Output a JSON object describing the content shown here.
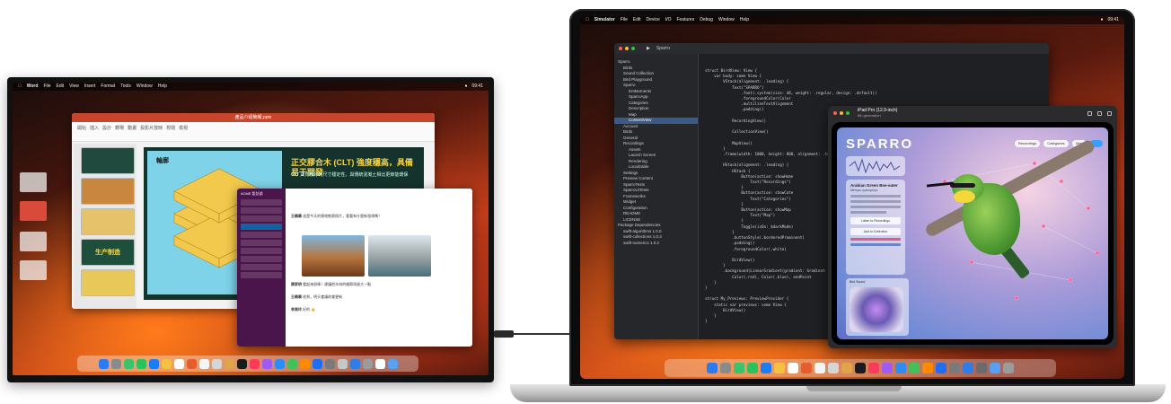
{
  "monitor": {
    "menubar": {
      "app": "Word",
      "items": [
        "File",
        "Edit",
        "View",
        "Insert",
        "Format",
        "Tools",
        "Window",
        "Help"
      ],
      "clock": "09:41"
    },
    "presentation": {
      "window_title": "產品介紹簡報.pptx",
      "ribbon_tabs": [
        "開始",
        "插入",
        "設計",
        "轉場",
        "動畫",
        "投影片放映",
        "校閱",
        "檢視"
      ],
      "slide_heading": "輪廓",
      "slide_title": "正交膠合木 (CLT) 強度穩高，具備易于開發",
      "slide_subtitle": "CLT 具有較好的尺寸穩定性，與傳統混凝土相比更節能環保",
      "thumb_label": "生产制造"
    },
    "chat": {
      "workspace": "ACME 設計部",
      "messages": [
        {
          "author": "王曉華",
          "text": "這是今天的實地勘察照片，看看有什麼新發現嗎？"
        },
        {
          "author": "陳家明",
          "text": "看起來很棒！建議把木材的細節再放大一點"
        },
        {
          "author": "王曉華",
          "text": "收到，明天會議前會更新"
        },
        {
          "author": "李美玲",
          "text": "好的 👍"
        }
      ]
    },
    "dock_colors": [
      "#2b7bf0",
      "#8a8a8a",
      "#3ac36b",
      "#2cc25b",
      "#1b7cf6",
      "#f6c040",
      "#ffffff",
      "#e55c2e",
      "#f5f5f5",
      "#d5d5d5",
      "#e0a54a",
      "#1b1b1b",
      "#fb3b5b",
      "#a05af5",
      "#2d8cf5",
      "#44c05a",
      "#ff8a00",
      "#1f6df2",
      "#7a7a7a",
      "#c7c7c7",
      "#2f7ee8",
      "#9b9b9b",
      "#ffffff",
      "#5aa0f0"
    ]
  },
  "macbook": {
    "menubar": {
      "app": "Simulator",
      "items": [
        "File",
        "Edit",
        "Device",
        "I/O",
        "Features",
        "Debug",
        "Window",
        "Help"
      ],
      "clock": "09:41"
    },
    "xcode": {
      "scheme": "Sparro",
      "navigator": [
        {
          "label": "Sparro",
          "indent": 0
        },
        {
          "label": "Birds",
          "indent": 1
        },
        {
          "label": "Sound Collection",
          "indent": 1
        },
        {
          "label": "Bird Playground",
          "indent": 1
        },
        {
          "label": "Sparro",
          "indent": 1
        },
        {
          "label": "EntMoments",
          "indent": 2
        },
        {
          "label": "SparroApp",
          "indent": 2
        },
        {
          "label": "Categories",
          "indent": 2
        },
        {
          "label": "Description",
          "indent": 2
        },
        {
          "label": "Map",
          "indent": 2
        },
        {
          "label": "ContentView",
          "indent": 2,
          "selected": true
        },
        {
          "label": "Account",
          "indent": 1
        },
        {
          "label": "Birds",
          "indent": 1
        },
        {
          "label": "General",
          "indent": 1
        },
        {
          "label": "Recordings",
          "indent": 1
        },
        {
          "label": "Assets",
          "indent": 2
        },
        {
          "label": "Launch Screen",
          "indent": 2
        },
        {
          "label": "Rendering",
          "indent": 2
        },
        {
          "label": "Localizable",
          "indent": 2
        },
        {
          "label": "Settings",
          "indent": 1
        },
        {
          "label": "Preview Content",
          "indent": 1
        },
        {
          "label": "SparroTests",
          "indent": 1
        },
        {
          "label": "SparroUITests",
          "indent": 1
        },
        {
          "label": "Frameworks",
          "indent": 1
        },
        {
          "label": "Widget",
          "indent": 1
        },
        {
          "label": "Configuration",
          "indent": 1
        },
        {
          "label": "README",
          "indent": 1
        },
        {
          "label": "LICENSE",
          "indent": 1
        },
        {
          "label": "Package Dependencies",
          "indent": 0
        },
        {
          "label": "swift-algorithms 1.0.0",
          "indent": 1
        },
        {
          "label": "swift-collections 1.0.3",
          "indent": 1
        },
        {
          "label": "swift-numerics 1.0.2",
          "indent": 1
        }
      ],
      "code_lines": [
        "struct BirdView: View {",
        "    var body: some View {",
        "        VStack(alignment: .leading) {",
        "            Text(\"SPARRO\")",
        "                .font(.system(size: 48, weight: .regular, design: .default))",
        "                .foregroundColor(Color",
        "                .multilineTextAlignment",
        "                .padding()",
        "",
        "            RecordingView()",
        "",
        "            CollectionView()",
        "",
        "            MapView()",
        "        }",
        "        .frame(width: 1000, height: 800, alignment: .top)",
        "",
        "        HStack(alignment: .leading) {",
        "            HStack {",
        "                Button(action: showHome",
        "                    Text(\"Recordings\")",
        "                }",
        "                Button(action: showCate",
        "                    Text(\"Categories\")",
        "                }",
        "                Button(action: showMap",
        "                    Text(\"Map\")",
        "                }",
        "                Toggle(isOn: $darkMode)",
        "            }",
        "            .buttonStyle(.borderedProminent)",
        "            .padding()",
        "            .foregroundColor(.white)",
        "",
        "            BirdView()",
        "        }",
        "        .background(LinearGradient(gradient: Gradient",
        "            Color(.red), Color(.blue), endPoint",
        "    }",
        "}",
        "",
        "struct My_Previews: PreviewProvider {",
        "    static var previews: some View {",
        "        BirdView()",
        "    }",
        "}"
      ]
    },
    "preview": {
      "device": "iPad Pro (12.9-inch)",
      "subtitle": "6th generation",
      "app_title": "SPARRO",
      "pills": [
        "Recordings",
        "Categories",
        "Map"
      ],
      "bird_name": "Arabian Green Bee-eater",
      "bird_latin": "Merops cyanophrys",
      "card_actions": [
        "Listen to Recordings",
        "Add to Collection"
      ],
      "orb_label": "Bird Sound"
    },
    "dock_colors": [
      "#2b7bf0",
      "#8a8a8a",
      "#3ac36b",
      "#2cc25b",
      "#1b7cf6",
      "#f6c040",
      "#ffffff",
      "#e55c2e",
      "#f5f5f5",
      "#d5d5d5",
      "#e0a54a",
      "#1b1b1b",
      "#fb3b5b",
      "#a05af5",
      "#2d8cf5",
      "#44c05a",
      "#ff8a00",
      "#1f6df2",
      "#7a7a7a",
      "#2f7ee8",
      "#6b6b6b",
      "#5aa0f0",
      "#9b9b9b"
    ]
  }
}
